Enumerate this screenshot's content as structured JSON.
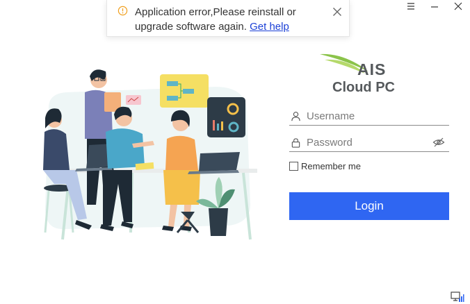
{
  "window": {
    "controls": [
      "menu-icon",
      "minimize-icon",
      "close-icon"
    ]
  },
  "toast": {
    "icon": "warning-icon",
    "message": "Application error,Please reinstall or upgrade software again.",
    "link_text": "Get help",
    "close_icon": "close-icon"
  },
  "brand": {
    "name": "AIS",
    "product": "Cloud PC",
    "colors": {
      "green": "#8bc34a",
      "gray": "#55595c"
    }
  },
  "login": {
    "username_placeholder": "Username",
    "password_placeholder": "Password",
    "remember_label": "Remember me",
    "remember_checked": false,
    "button_label": "Login",
    "button_color": "#2f66f2"
  },
  "status": {
    "network_icon": "network-icon"
  }
}
